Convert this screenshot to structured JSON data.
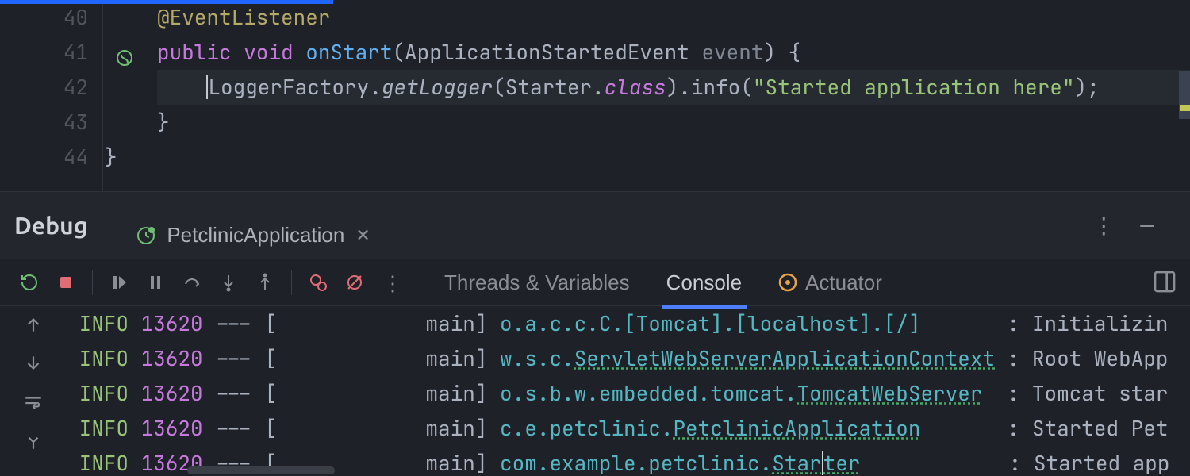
{
  "editor": {
    "lines": [
      {
        "no": "40",
        "tokens": [
          [
            "ann",
            "@EventListener"
          ]
        ]
      },
      {
        "no": "41",
        "icon": "impl-icon",
        "tokens": [
          [
            "key",
            "public "
          ],
          [
            "key",
            "void "
          ],
          [
            "method",
            "onStart"
          ],
          [
            "brace",
            "("
          ],
          [
            "type",
            "ApplicationStartedEvent "
          ],
          [
            "param",
            "event"
          ],
          [
            "brace",
            ") {"
          ]
        ]
      },
      {
        "no": "42",
        "hl": true,
        "indent": 1,
        "tokens": [
          [
            "cursor",
            ""
          ],
          [
            "def",
            "LoggerFactory"
          ],
          [
            "brace",
            "."
          ],
          [
            "call",
            "getLogger"
          ],
          [
            "brace",
            "("
          ],
          [
            "def",
            "Starter"
          ],
          [
            "brace",
            "."
          ],
          [
            "field",
            "class"
          ],
          [
            "brace",
            ")."
          ],
          [
            "def",
            "info"
          ],
          [
            "brace",
            "("
          ],
          [
            "str",
            "\"Started application here\""
          ],
          [
            "brace",
            ");"
          ]
        ]
      },
      {
        "no": "43",
        "tokens": [
          [
            "brace",
            "}"
          ]
        ]
      },
      {
        "no": "44",
        "indent": -1,
        "tokens": [
          [
            "brace",
            "}"
          ]
        ]
      }
    ]
  },
  "panel": {
    "title": "Debug",
    "tabs": [
      {
        "label": "PetclinicApplication",
        "closable": true,
        "active": true
      }
    ]
  },
  "toolbar": {
    "tabs": [
      {
        "label": "Threads & Variables",
        "active": false
      },
      {
        "label": "Console",
        "active": true
      },
      {
        "label": "Actuator",
        "active": false,
        "icon": "spring-icon"
      }
    ]
  },
  "console": {
    "lines": [
      {
        "level": "INFO",
        "pid": "13620",
        "thread": "main",
        "logger": "o.a.c.c.C.[Tomcat].[localhost].[/]",
        "logger_u": "",
        "msg": ": Initializin"
      },
      {
        "level": "INFO",
        "pid": "13620",
        "thread": "main",
        "logger": "w.s.c.",
        "logger_u": "ServletWebServerApplicationContext",
        "msg": ": Root WebApp"
      },
      {
        "level": "INFO",
        "pid": "13620",
        "thread": "main",
        "logger": "o.s.b.w.embedded.tomcat.",
        "logger_u": "TomcatWebServer",
        "msg": ": Tomcat star"
      },
      {
        "level": "INFO",
        "pid": "13620",
        "thread": "main",
        "logger": "c.e.petclinic.",
        "logger_u": "PetclinicApplication",
        "msg": ": Started Pet"
      },
      {
        "level": "INFO",
        "pid": "13620",
        "thread": "main",
        "logger": "com.example.petclinic.",
        "logger_u": "Starter",
        "cursor_idx": 4,
        "msg": ": Started app"
      }
    ]
  }
}
